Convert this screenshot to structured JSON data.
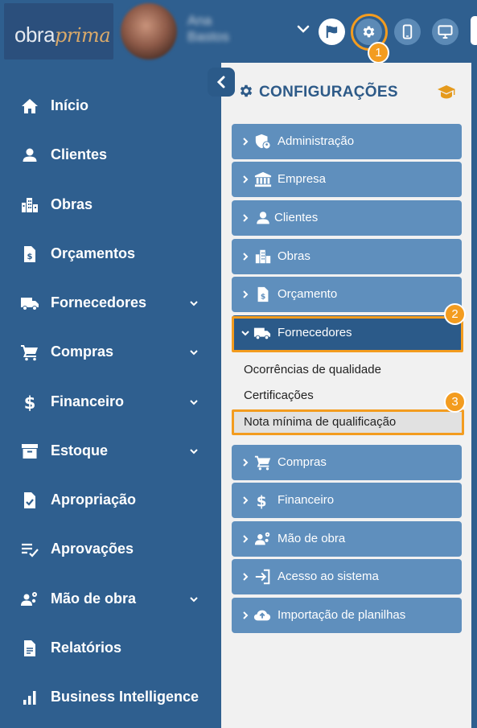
{
  "logo": {
    "part1": "obra",
    "part2": "prima"
  },
  "user": {
    "line1": "Ana",
    "line2": "Bastos"
  },
  "header_buttons": [
    "flag-icon",
    "gear-icon",
    "mobile-icon",
    "desktop-icon"
  ],
  "steps": {
    "one": "1",
    "two": "2",
    "three": "3"
  },
  "sidebar": {
    "items": [
      {
        "label": "Início",
        "icon": "home-icon"
      },
      {
        "label": "Clientes",
        "icon": "user-icon"
      },
      {
        "label": "Obras",
        "icon": "buildings-icon"
      },
      {
        "label": "Orçamentos",
        "icon": "file-dollar-icon"
      },
      {
        "label": "Fornecedores",
        "icon": "truck-icon",
        "expandable": true
      },
      {
        "label": "Compras",
        "icon": "cart-icon",
        "expandable": true
      },
      {
        "label": "Financeiro",
        "icon": "dollar-icon",
        "expandable": true
      },
      {
        "label": "Estoque",
        "icon": "archive-icon",
        "expandable": true
      },
      {
        "label": "Apropriação",
        "icon": "file-check-icon"
      },
      {
        "label": "Aprovações",
        "icon": "list-check-icon"
      },
      {
        "label": "Mão de obra",
        "icon": "workers-icon",
        "expandable": true
      },
      {
        "label": "Relatórios",
        "icon": "file-text-icon"
      },
      {
        "label": "Business Intelligence",
        "icon": "bar-chart-icon"
      }
    ]
  },
  "panel": {
    "title": "CONFIGURAÇÕES",
    "items": [
      {
        "label": "Administração",
        "icon": "shield-user-icon"
      },
      {
        "label": "Empresa",
        "icon": "bank-icon"
      },
      {
        "label": "Clientes",
        "icon": "user-icon"
      },
      {
        "label": "Obras",
        "icon": "buildings-icon"
      },
      {
        "label": "Orçamento",
        "icon": "file-dollar-icon"
      },
      {
        "label": "Fornecedores",
        "icon": "truck-icon",
        "expanded": true
      },
      {
        "label": "Compras",
        "icon": "cart-icon"
      },
      {
        "label": "Financeiro",
        "icon": "dollar-icon"
      },
      {
        "label": "Mão de obra",
        "icon": "workers-icon"
      },
      {
        "label": "Acesso ao sistema",
        "icon": "sign-in-icon"
      },
      {
        "label": "Importação de planilhas",
        "icon": "cloud-upload-icon"
      }
    ],
    "fornecedores_submenu": [
      "Ocorrências de qualidade",
      "Certificações",
      "Nota mínima de qualificação"
    ]
  },
  "colors": {
    "primary": "#2f5f8f",
    "item": "#5f8fbd",
    "active": "#2b5a89",
    "highlight": "#f39c1f"
  }
}
